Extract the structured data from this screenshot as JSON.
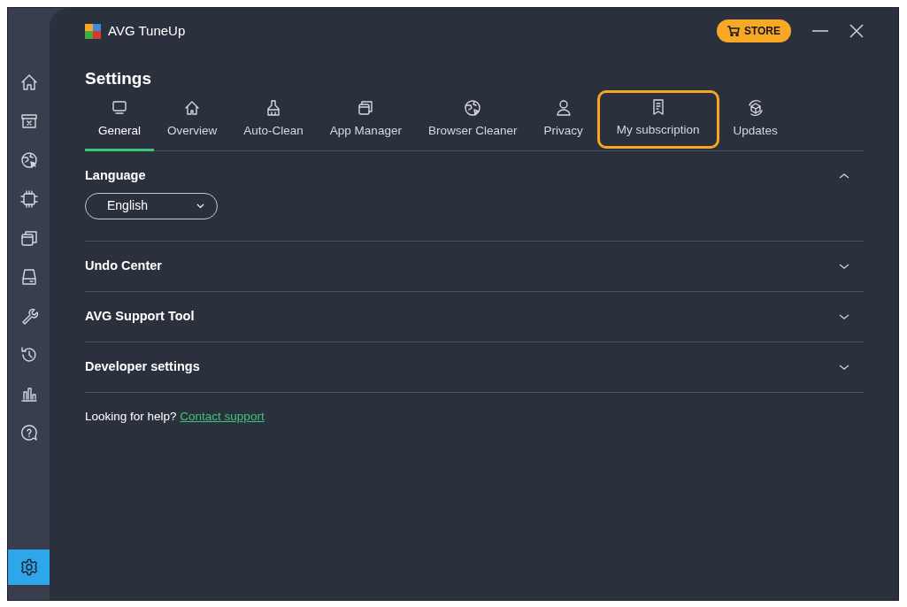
{
  "window": {
    "title": "AVG TuneUp",
    "store_button": "STORE"
  },
  "sidebar": {
    "items": [
      {
        "selected": false
      },
      {
        "selected": false
      },
      {
        "selected": false
      },
      {
        "selected": false
      },
      {
        "selected": false
      },
      {
        "selected": false
      },
      {
        "selected": false
      },
      {
        "selected": false
      },
      {
        "selected": false
      },
      {
        "selected": false
      }
    ],
    "settings": {
      "selected": true
    }
  },
  "page_title": "Settings",
  "tabs": [
    {
      "label": "General",
      "selected": true,
      "highlighted": false
    },
    {
      "label": "Overview",
      "selected": false,
      "highlighted": false
    },
    {
      "label": "Auto-Clean",
      "selected": false,
      "highlighted": false
    },
    {
      "label": "App Manager",
      "selected": false,
      "highlighted": false
    },
    {
      "label": "Browser Cleaner",
      "selected": false,
      "highlighted": false
    },
    {
      "label": "Privacy",
      "selected": false,
      "highlighted": false
    },
    {
      "label": "My subscription",
      "selected": false,
      "highlighted": true
    },
    {
      "label": "Updates",
      "selected": false,
      "highlighted": false
    }
  ],
  "sections": [
    {
      "title": "Language",
      "expanded": true,
      "dropdown": {
        "value": "English"
      }
    },
    {
      "title": "Undo Center",
      "expanded": false
    },
    {
      "title": "AVG Support Tool",
      "expanded": false
    },
    {
      "title": "Developer settings",
      "expanded": false
    }
  ],
  "help": {
    "text": "Looking for help?",
    "link": "Contact support"
  }
}
